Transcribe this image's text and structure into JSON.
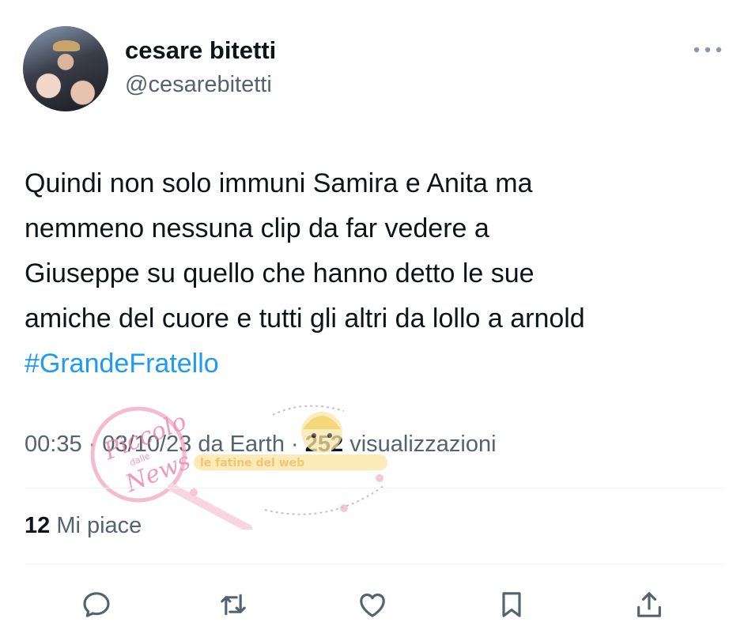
{
  "author": {
    "display_name": "cesare bitetti",
    "handle": "@cesarebitetti"
  },
  "menu": {
    "icon": "more-horizontal-icon"
  },
  "tweet": {
    "lines": [
      "Quindi non solo immuni Samira e Anita ma",
      "nemmeno nessuna clip da far vedere a",
      "Giuseppe su quello che hanno detto le sue",
      "amiche del cuore e tutti gli altri da lollo a arnold"
    ],
    "hashtag": "#GrandeFratello"
  },
  "meta": {
    "time": "00:35",
    "separator": "·",
    "date": "03/10/23",
    "source": "da Earth",
    "views_count": "252",
    "views_label": "visualizzazioni"
  },
  "engagement": {
    "likes_count": "12",
    "likes_label": "Mi piace"
  },
  "actions": [
    {
      "name": "reply",
      "icon": "reply-icon"
    },
    {
      "name": "retweet",
      "icon": "retweet-icon"
    },
    {
      "name": "like",
      "icon": "heart-icon"
    },
    {
      "name": "bookmark",
      "icon": "bookmark-icon"
    },
    {
      "name": "share",
      "icon": "share-icon"
    }
  ],
  "watermark": {
    "text_main": "Piccolo",
    "text_small": "dalle",
    "text_news": "News",
    "banner": "le fatine del web"
  },
  "colors": {
    "text": "#0f1419",
    "secondary": "#536471",
    "link": "#1d9bf0",
    "divider": "#eff3f4"
  }
}
